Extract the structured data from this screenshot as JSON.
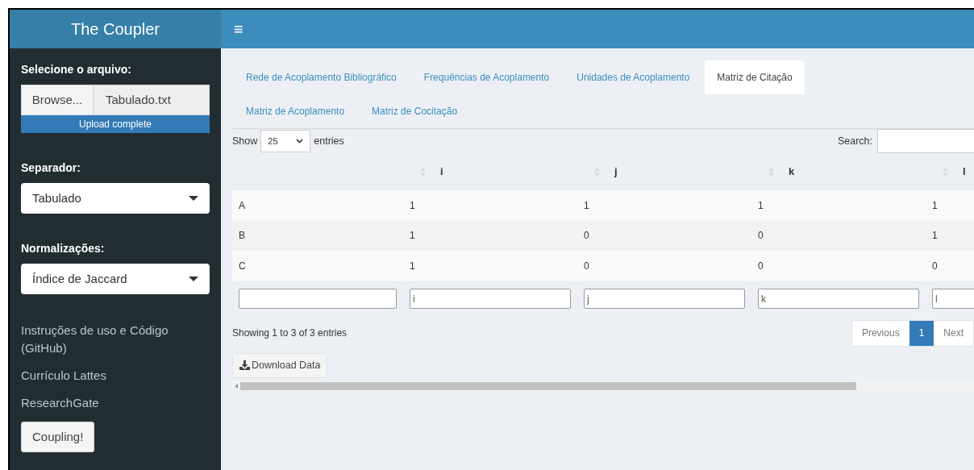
{
  "sidebar": {
    "title": "The Coupler",
    "file_input": {
      "label": "Selecione o arquivo:",
      "button": "Browse...",
      "filename": "Tabulado.txt",
      "progress": "Upload complete",
      "level": 1
    },
    "selects": [
      {
        "label": "Separador:",
        "value": "Tabulado"
      },
      {
        "label": "Normalizações:",
        "value": "Índice de Jaccard"
      }
    ],
    "links": [
      "Instruções de uso e Código (GitHub)",
      "Currículo Lattes",
      "ResearchGate"
    ],
    "button": "Coupling!"
  },
  "header": {
    "menu_icon": "≡"
  },
  "tabs": [
    {
      "label": "Rede de Acoplamento Bibliográfico",
      "selected": false
    },
    {
      "label": "Frequências de Acoplamento",
      "selected": false
    },
    {
      "label": "Unidades de Acoplamento",
      "selected": false
    },
    {
      "label": "Matriz de Citação",
      "selected": true
    },
    {
      "label": "Matriz de Acoplamento",
      "selected": false
    },
    {
      "label": "Matriz de Cocitação",
      "selected": false
    }
  ],
  "table_controls": {
    "show": "Show",
    "page_length": "25",
    "entries": "entries",
    "search_label": "Search:"
  },
  "table": {
    "columns": [
      "",
      "i",
      "j",
      "k",
      "l"
    ],
    "rows": [
      [
        "A",
        "1",
        "1",
        "1",
        "1"
      ],
      [
        "B",
        "1",
        "0",
        "0",
        "1"
      ],
      [
        "C",
        "1",
        "0",
        "0",
        "0"
      ]
    ],
    "filters": [
      "i",
      "j",
      "k",
      "l"
    ]
  },
  "info": "Showing 1 to 3 of 3 entries",
  "pagination": [
    {
      "label": "Previous",
      "selected": false
    },
    {
      "label": "1",
      "selected": true
    },
    {
      "label": "Next",
      "selected": false
    }
  ],
  "download_button": "Download Data"
}
